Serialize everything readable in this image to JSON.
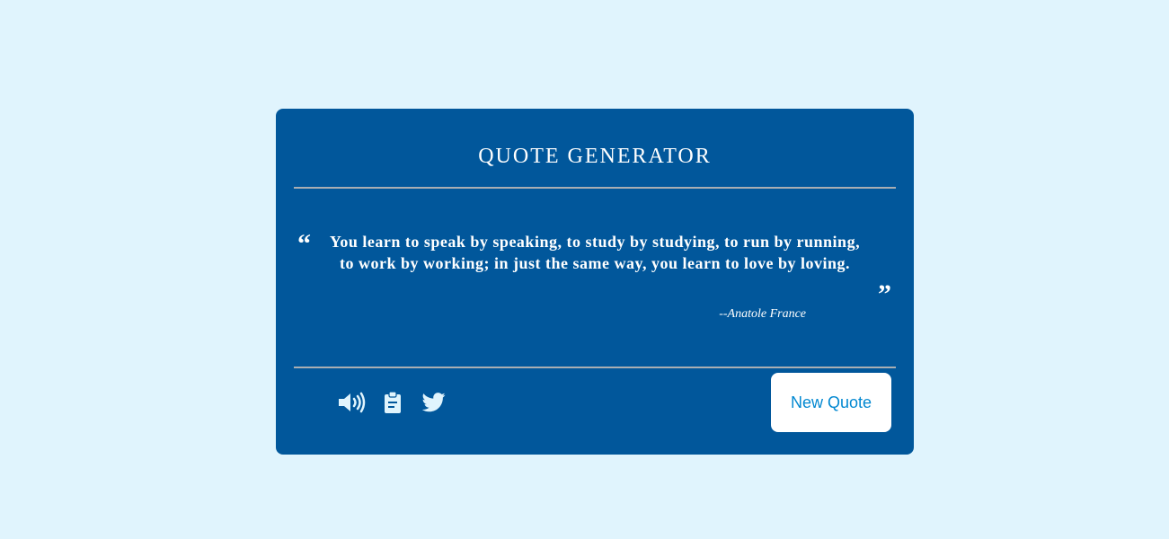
{
  "app": {
    "title": "QUOTE GENERATOR"
  },
  "quote": {
    "open_mark": "“",
    "text": "You learn to speak by speaking, to study by studying, to run by running, to work by working; in just the same way, you learn to love by loving.",
    "close_mark": "”",
    "author": "--Anatole France"
  },
  "actions": {
    "icons": [
      "speaker-icon",
      "clipboard-icon",
      "twitter-icon"
    ],
    "new_quote_label": "New Quote"
  },
  "colors": {
    "background": "#e0f4fd",
    "card": "#01579b",
    "divider": "#a9aeb3",
    "text": "#ffffff",
    "button_text": "#0288d1"
  }
}
